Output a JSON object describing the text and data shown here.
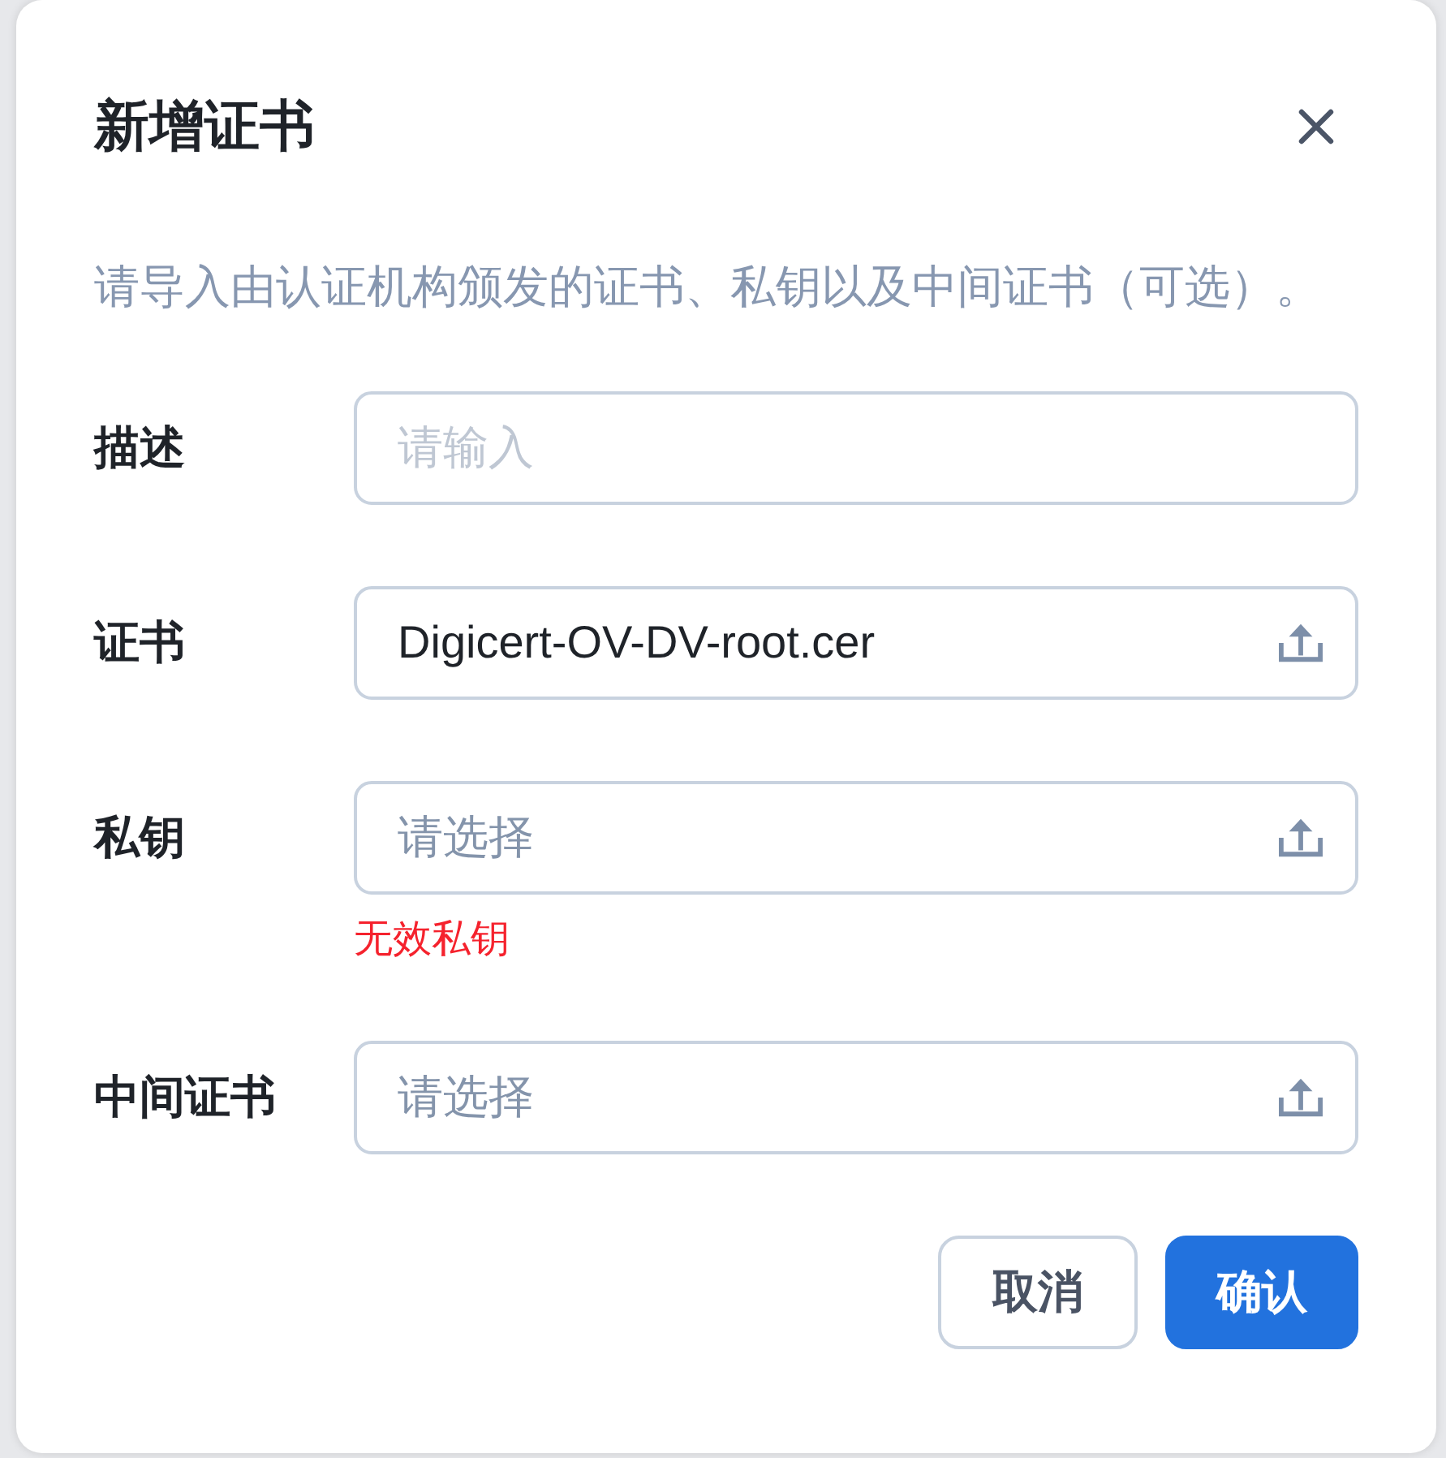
{
  "dialog": {
    "title": "新增证书",
    "description": "请导入由认证机构颁发的证书、私钥以及中间证书（可选）。",
    "fields": [
      {
        "kind": "text",
        "label": "描述",
        "placeholder": "请输入"
      },
      {
        "kind": "upload",
        "label": "证书",
        "value": "Digicert-OV-DV-root.cer"
      },
      {
        "kind": "upload",
        "label": "私钥",
        "placeholder": "请选择",
        "error": "无效私钥"
      },
      {
        "kind": "upload",
        "label": "中间证书",
        "placeholder": "请选择"
      }
    ],
    "buttons": [
      {
        "kind": "secondary",
        "label": "取消"
      },
      {
        "kind": "primary",
        "label": "确认"
      }
    ]
  }
}
